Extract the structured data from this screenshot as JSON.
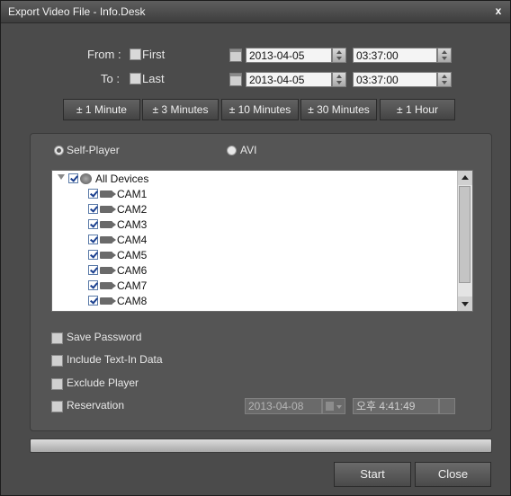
{
  "window": {
    "title": "Export Video File - Info.Desk",
    "close_label": "x"
  },
  "from": {
    "label": "From :",
    "check_label": "First",
    "date": "2013-04-05",
    "time": "03:37:00"
  },
  "to": {
    "label": "To :",
    "check_label": "Last",
    "date": "2013-04-05",
    "time": "03:37:00"
  },
  "quick_buttons": [
    "± 1 Minute",
    "± 3 Minutes",
    "± 10 Minutes",
    "± 30 Minutes",
    "± 1 Hour"
  ],
  "format": {
    "self_player": "Self-Player",
    "avi": "AVI",
    "selected": "Self-Player"
  },
  "tree": {
    "root": "All Devices",
    "cams": [
      "CAM1",
      "CAM2",
      "CAM3",
      "CAM4",
      "CAM5",
      "CAM6",
      "CAM7",
      "CAM8"
    ]
  },
  "options": {
    "save_password": "Save Password",
    "include_text": "Include Text-In Data",
    "exclude_player": "Exclude Player",
    "reservation": "Reservation"
  },
  "reservation": {
    "date": "2013-04-08",
    "time": "오후 4:41:49"
  },
  "buttons": {
    "start": "Start",
    "close": "Close"
  }
}
